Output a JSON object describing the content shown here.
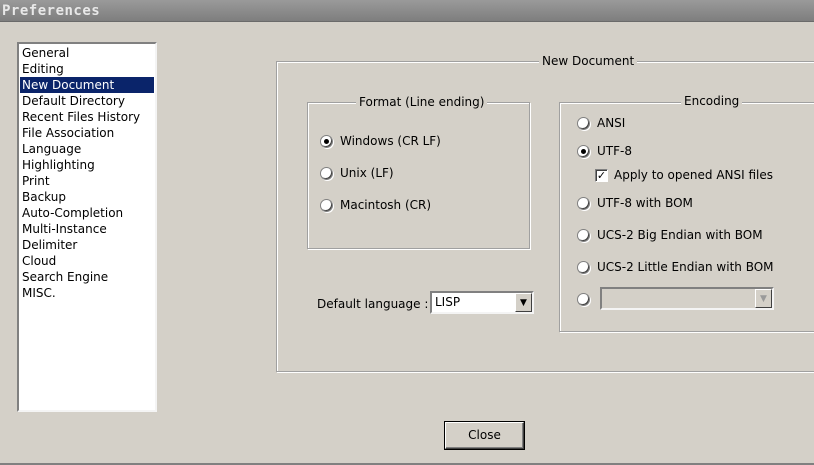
{
  "window": {
    "title": "Preferences"
  },
  "sidebar": {
    "items": [
      {
        "label": "General"
      },
      {
        "label": "Editing"
      },
      {
        "label": "New Document",
        "selected": true
      },
      {
        "label": "Default Directory"
      },
      {
        "label": "Recent Files History"
      },
      {
        "label": "File Association"
      },
      {
        "label": "Language"
      },
      {
        "label": "Highlighting"
      },
      {
        "label": "Print"
      },
      {
        "label": "Backup"
      },
      {
        "label": "Auto-Completion"
      },
      {
        "label": "Multi-Instance"
      },
      {
        "label": "Delimiter"
      },
      {
        "label": "Cloud"
      },
      {
        "label": "Search Engine"
      },
      {
        "label": "MISC."
      }
    ]
  },
  "new_document": {
    "group_label": "New Document",
    "format": {
      "label": "Format (Line ending)",
      "options": [
        {
          "label": "Windows (CR LF)",
          "checked": true
        },
        {
          "label": "Unix (LF)",
          "checked": false
        },
        {
          "label": "Macintosh (CR)",
          "checked": false
        }
      ]
    },
    "default_language": {
      "label": "Default language :",
      "value": "LISP"
    },
    "encoding": {
      "label": "Encoding",
      "ansi": "ANSI",
      "utf8": "UTF-8",
      "apply_ansi": "Apply to opened ANSI files",
      "utf8_bom": "UTF-8 with BOM",
      "ucs2_be": "UCS-2 Big Endian with BOM",
      "ucs2_le": "UCS-2 Little Endian with BOM",
      "selected": "UTF-8",
      "apply_ansi_checked": true,
      "other_value": ""
    }
  },
  "footer": {
    "close_label": "Close"
  }
}
